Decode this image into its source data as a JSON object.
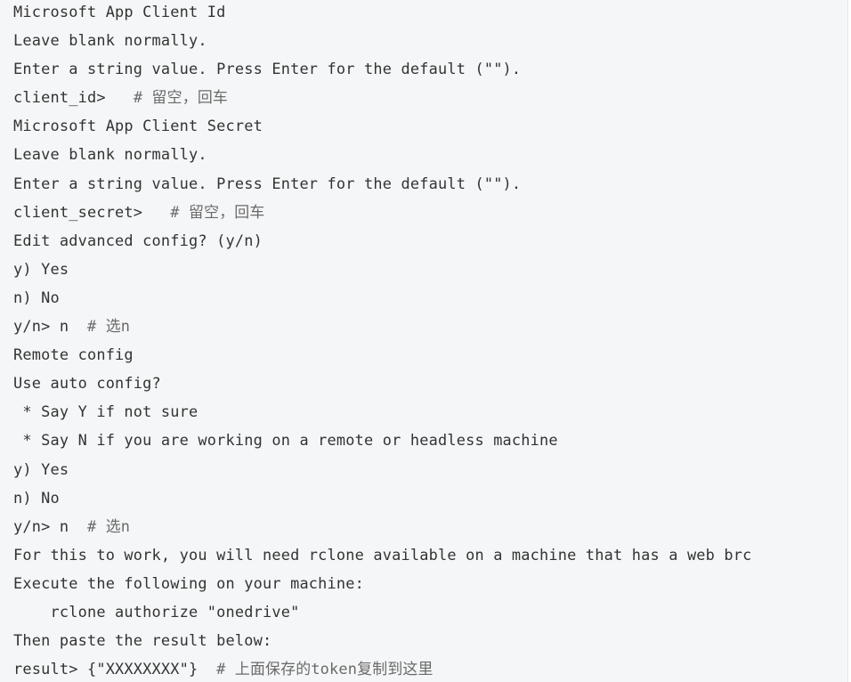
{
  "terminal": {
    "lines": [
      {
        "text": "Microsoft App Client Id",
        "comment": ""
      },
      {
        "text": "Leave blank normally.",
        "comment": ""
      },
      {
        "text": "Enter a string value. Press Enter for the default (\"\").",
        "comment": ""
      },
      {
        "text": "client_id>   ",
        "comment": "# 留空，回车"
      },
      {
        "text": "Microsoft App Client Secret",
        "comment": ""
      },
      {
        "text": "Leave blank normally.",
        "comment": ""
      },
      {
        "text": "Enter a string value. Press Enter for the default (\"\").",
        "comment": ""
      },
      {
        "text": "client_secret>   ",
        "comment": "# 留空，回车"
      },
      {
        "text": "Edit advanced config? (y/n)",
        "comment": ""
      },
      {
        "text": "y) Yes",
        "comment": ""
      },
      {
        "text": "n) No",
        "comment": ""
      },
      {
        "text": "y/n> n  ",
        "comment": "# 选n"
      },
      {
        "text": "Remote config",
        "comment": ""
      },
      {
        "text": "Use auto config?",
        "comment": ""
      },
      {
        "text": " * Say Y if not sure",
        "comment": ""
      },
      {
        "text": " * Say N if you are working on a remote or headless machine",
        "comment": ""
      },
      {
        "text": "y) Yes",
        "comment": ""
      },
      {
        "text": "n) No",
        "comment": ""
      },
      {
        "text": "y/n> n  ",
        "comment": "# 选n"
      },
      {
        "text": "For this to work, you will need rclone available on a machine that has a web brc",
        "comment": ""
      },
      {
        "text": "Execute the following on your machine:",
        "comment": ""
      },
      {
        "text": "    rclone authorize \"onedrive\"",
        "comment": ""
      },
      {
        "text": "Then paste the result below:",
        "comment": ""
      },
      {
        "text": "result> {\"XXXXXXXX\"}  ",
        "comment": "# 上面保存的token复制到这里"
      }
    ]
  }
}
